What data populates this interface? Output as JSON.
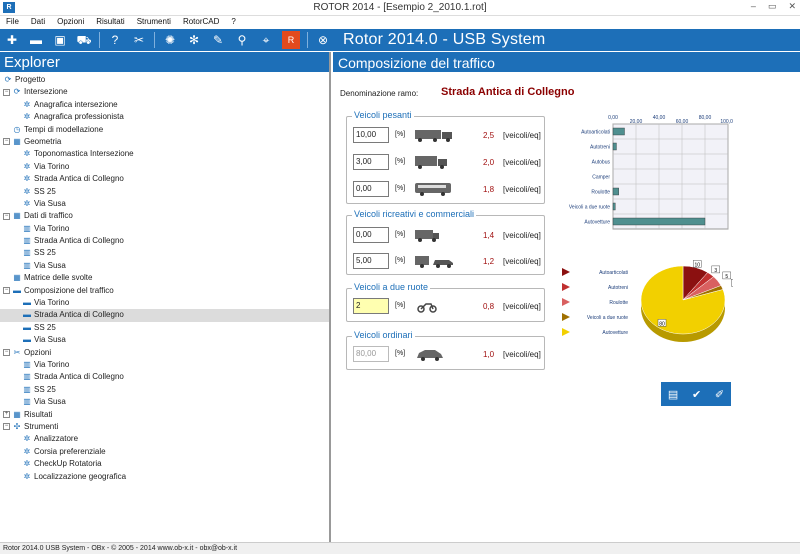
{
  "window": {
    "title": "ROTOR 2014 - [Esempio 2_2010.1.rot]",
    "icon_label": "R",
    "minimize": "–",
    "restore": "▭",
    "close": "✕"
  },
  "menu": [
    "File",
    "Dati",
    "Opzioni",
    "Risultati",
    "Strumenti",
    "RotorCAD",
    "?"
  ],
  "toolbar": {
    "title": "Rotor 2014.0 - USB System",
    "icons": [
      "plus-icon",
      "minus-icon",
      "save-icon",
      "car-icon",
      "help-icon",
      "tools-icon",
      "roundabout-icon",
      "roundabout-lanes-icon",
      "roundabout-edit-icon",
      "roundabout-search-icon",
      "map-pin-icon",
      "office-icon",
      "close-circle-icon"
    ]
  },
  "explorer": {
    "title": "Explorer",
    "items": [
      {
        "label": "Progetto",
        "level": 0,
        "exp": "",
        "icon": "project-icon"
      },
      {
        "label": "Intersezione",
        "level": 0,
        "exp": "−",
        "icon": "roundabout-icon"
      },
      {
        "label": "Anagrafica intersezione",
        "level": 2,
        "exp": "",
        "icon": "gear-icon"
      },
      {
        "label": "Anagrafica professionista",
        "level": 2,
        "exp": "",
        "icon": "gear-icon"
      },
      {
        "label": "Tempi di modellazione",
        "level": 1,
        "exp": "",
        "icon": "clock-icon"
      },
      {
        "label": "Geometria",
        "level": 0,
        "exp": "−",
        "icon": "geometry-icon"
      },
      {
        "label": "Toponomastica Intersezione",
        "level": 2,
        "exp": "",
        "icon": "gear-icon"
      },
      {
        "label": "Via Torino",
        "level": 2,
        "exp": "",
        "icon": "gear-icon"
      },
      {
        "label": "Strada Antica di Collegno",
        "level": 2,
        "exp": "",
        "icon": "gear-icon"
      },
      {
        "label": "SS 25",
        "level": 2,
        "exp": "",
        "icon": "gear-icon"
      },
      {
        "label": "Via Susa",
        "level": 2,
        "exp": "",
        "icon": "gear-icon"
      },
      {
        "label": "Dati di traffico",
        "level": 0,
        "exp": "−",
        "icon": "traffic-data-icon"
      },
      {
        "label": "Via Torino",
        "level": 2,
        "exp": "",
        "icon": "bar-chart-icon"
      },
      {
        "label": "Strada Antica di Collegno",
        "level": 2,
        "exp": "",
        "icon": "bar-chart-icon"
      },
      {
        "label": "SS 25",
        "level": 2,
        "exp": "",
        "icon": "bar-chart-icon"
      },
      {
        "label": "Via Susa",
        "level": 2,
        "exp": "",
        "icon": "bar-chart-icon"
      },
      {
        "label": "Matrice delle svolte",
        "level": 1,
        "exp": "",
        "icon": "matrix-icon"
      },
      {
        "label": "Composizione del traffico",
        "level": 0,
        "exp": "−",
        "icon": "car-icon"
      },
      {
        "label": "Via Torino",
        "level": 2,
        "exp": "",
        "icon": "car-icon"
      },
      {
        "label": "Strada Antica di Collegno",
        "level": 2,
        "exp": "",
        "icon": "car-icon",
        "selected": true
      },
      {
        "label": "SS 25",
        "level": 2,
        "exp": "",
        "icon": "car-icon"
      },
      {
        "label": "Via Susa",
        "level": 2,
        "exp": "",
        "icon": "car-icon"
      },
      {
        "label": "Opzioni",
        "level": 0,
        "exp": "−",
        "icon": "tools-icon"
      },
      {
        "label": "Via Torino",
        "level": 2,
        "exp": "",
        "icon": "bar-chart-icon"
      },
      {
        "label": "Strada Antica di Collegno",
        "level": 2,
        "exp": "",
        "icon": "bar-chart-icon"
      },
      {
        "label": "SS 25",
        "level": 2,
        "exp": "",
        "icon": "bar-chart-icon"
      },
      {
        "label": "Via Susa",
        "level": 2,
        "exp": "",
        "icon": "bar-chart-icon"
      },
      {
        "label": "Risultati",
        "level": 0,
        "exp": "+",
        "icon": "results-icon"
      },
      {
        "label": "Strumenti",
        "level": 0,
        "exp": "−",
        "icon": "instruments-icon"
      },
      {
        "label": "Analizzatore",
        "level": 2,
        "exp": "",
        "icon": "gear-icon"
      },
      {
        "label": "Corsia preferenziale",
        "level": 2,
        "exp": "",
        "icon": "gear-icon"
      },
      {
        "label": "CheckUp Rotatoria",
        "level": 2,
        "exp": "",
        "icon": "gear-icon"
      },
      {
        "label": "Localizzazione geografica",
        "level": 2,
        "exp": "",
        "icon": "gear-icon"
      }
    ]
  },
  "panel": {
    "title": "Composizione del traffico",
    "den_label": "Denominazione ramo:",
    "den_value": "Strada Antica di Collegno",
    "groups": [
      {
        "title": "Veicoli pesanti",
        "rows": [
          {
            "value": "10,00",
            "pct": "[%]",
            "icon": "articulated-truck-icon",
            "factor": "2,5",
            "unit": "[veicoli/eq]"
          },
          {
            "value": "3,00",
            "pct": "[%]",
            "icon": "truck-icon",
            "factor": "2,0",
            "unit": "[veicoli/eq]"
          },
          {
            "value": "0,00",
            "pct": "[%]",
            "icon": "bus-icon",
            "factor": "1,8",
            "unit": "[veicoli/eq]"
          }
        ]
      },
      {
        "title": "Veicoli ricreativi e commerciali",
        "rows": [
          {
            "value": "0,00",
            "pct": "[%]",
            "icon": "camper-icon",
            "factor": "1,4",
            "unit": "[veicoli/eq]"
          },
          {
            "value": "5,00",
            "pct": "[%]",
            "icon": "car-trailer-icon",
            "factor": "1,2",
            "unit": "[veicoli/eq]"
          }
        ]
      },
      {
        "title": "Veicoli a due ruote",
        "rows": [
          {
            "value": "2",
            "pct": "[%]",
            "icon": "motorbike-icon",
            "factor": "0,8",
            "unit": "[veicoli/eq]",
            "focus": true
          }
        ]
      },
      {
        "title": "Veicoli ordinari",
        "rows": [
          {
            "value": "80,00",
            "pct": "[%]",
            "icon": "car-icon",
            "factor": "1,0",
            "unit": "[veicoli/eq]",
            "disabled": true
          }
        ]
      }
    ],
    "buttons": [
      "calculator-icon",
      "check-icon",
      "clear-icon"
    ]
  },
  "chart_data": [
    {
      "type": "bar",
      "orientation": "horizontal",
      "categories": [
        "Autoarticolati",
        "Autotreni",
        "Autobus",
        "Camper",
        "Roulotte",
        "Veicoli a due ruote",
        "Autovetture"
      ],
      "values": [
        10,
        3,
        0,
        0,
        5,
        2,
        80
      ],
      "xlim": [
        0,
        100
      ],
      "x_ticks": [
        "0,00",
        "20,00",
        "40,00",
        "60,00",
        "80,00",
        "100,00"
      ],
      "grid": true,
      "bar_color": "#4f8f8f"
    },
    {
      "type": "pie",
      "labels": [
        "Autoarticolati",
        "Autotreni",
        "Roulotte",
        "Veicoli a due ruote",
        "Autovetture"
      ],
      "values": [
        10,
        3,
        5,
        2,
        80
      ],
      "data_labels": [
        "10",
        "3",
        "5",
        "2",
        "80"
      ],
      "colors": [
        "#8b1010",
        "#c03030",
        "#d96060",
        "#a07000",
        "#f2d000"
      ],
      "legend": "left"
    }
  ],
  "statusbar": {
    "text": "Rotor 2014.0 USB System - OBx - © 2005 - 2014 www.ob-x.it - obx@ob-x.it"
  }
}
